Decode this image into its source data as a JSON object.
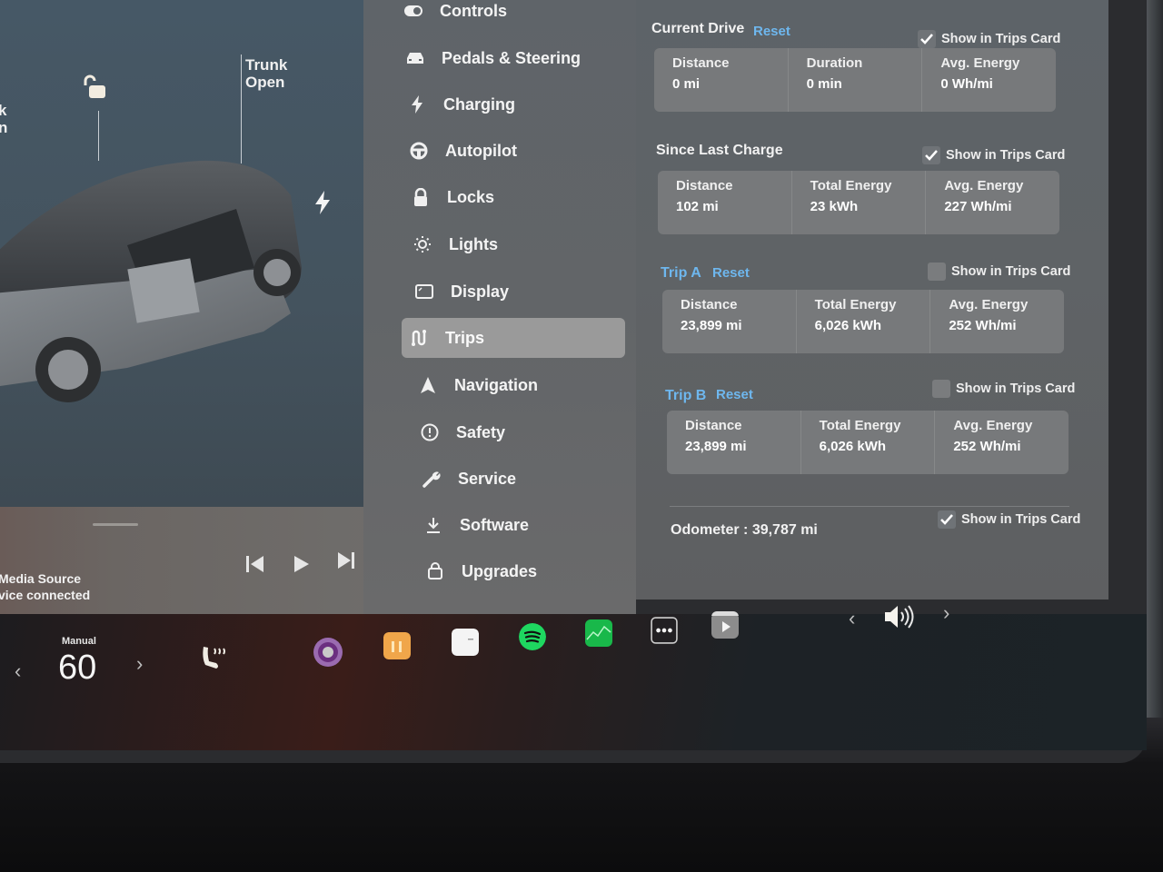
{
  "car_view": {
    "left_callout_partial": [
      "k",
      "n"
    ],
    "trunk_callout": [
      "Trunk",
      "Open"
    ],
    "icons": [
      "unlock-icon",
      "charge-port-icon"
    ]
  },
  "media_player": {
    "source_line1": "Media Source",
    "source_line2": "vice connected",
    "controls": [
      "previous-track",
      "play",
      "next-track"
    ]
  },
  "settings_menu": {
    "items": [
      {
        "label": "Controls",
        "icon": "toggle-icon"
      },
      {
        "label": "Pedals & Steering",
        "icon": "car-icon"
      },
      {
        "label": "Charging",
        "icon": "bolt-icon"
      },
      {
        "label": "Autopilot",
        "icon": "steering-wheel-icon"
      },
      {
        "label": "Locks",
        "icon": "lock-icon"
      },
      {
        "label": "Lights",
        "icon": "sun-icon"
      },
      {
        "label": "Display",
        "icon": "display-icon"
      },
      {
        "label": "Trips",
        "icon": "trips-icon",
        "active": true
      },
      {
        "label": "Navigation",
        "icon": "navigation-arrow-icon"
      },
      {
        "label": "Safety",
        "icon": "alert-circle-icon"
      },
      {
        "label": "Service",
        "icon": "wrench-icon"
      },
      {
        "label": "Software",
        "icon": "download-icon"
      },
      {
        "label": "Upgrades",
        "icon": "bag-icon"
      }
    ]
  },
  "trips": {
    "show_label": "Show in Trips Card",
    "reset_label": "Reset",
    "current_drive": {
      "title": "Current Drive",
      "show_in_card": true,
      "stats": [
        {
          "label": "Distance",
          "value": "0 mi"
        },
        {
          "label": "Duration",
          "value": "0 min"
        },
        {
          "label": "Avg. Energy",
          "value": "0 Wh/mi"
        }
      ]
    },
    "since_last_charge": {
      "title": "Since Last Charge",
      "show_in_card": true,
      "stats": [
        {
          "label": "Distance",
          "value": "102 mi"
        },
        {
          "label": "Total Energy",
          "value": "23 kWh"
        },
        {
          "label": "Avg. Energy",
          "value": "227 Wh/mi"
        }
      ]
    },
    "trip_a": {
      "title": "Trip A",
      "show_in_card": false,
      "stats": [
        {
          "label": "Distance",
          "value": "23,899 mi"
        },
        {
          "label": "Total Energy",
          "value": "6,026 kWh"
        },
        {
          "label": "Avg. Energy",
          "value": "252 Wh/mi"
        }
      ]
    },
    "trip_b": {
      "title": "Trip B",
      "show_in_card": false,
      "stats": [
        {
          "label": "Distance",
          "value": "23,899 mi"
        },
        {
          "label": "Total Energy",
          "value": "6,026 kWh"
        },
        {
          "label": "Avg. Energy",
          "value": "252 Wh/mi"
        }
      ]
    },
    "odometer": {
      "label": "Odometer",
      "separator": ":",
      "value": "39,787 mi",
      "show_in_card": true
    }
  },
  "dock": {
    "climate_mode": "Manual",
    "temperature": "60",
    "apps": [
      "camera-app",
      "toybox-app",
      "calendar-app",
      "spotify-app",
      "energy-app",
      "more-apps",
      "theater-app"
    ],
    "volume_icon": "speaker-volume-icon"
  },
  "colors": {
    "accent_blue": "#6eb7ee",
    "spotify_green": "#1ed760",
    "energy_green": "#19b84a"
  }
}
